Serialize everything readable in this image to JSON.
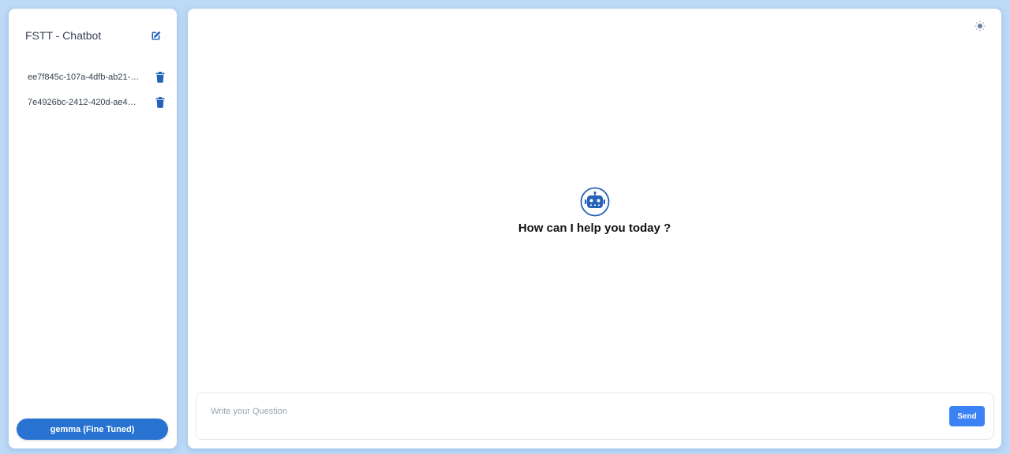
{
  "sidebar": {
    "title": "FSTT - Chatbot",
    "new_chat_icon": "edit-icon",
    "chats": [
      {
        "label": "ee7f845c-107a-4dfb-ab21-a…",
        "delete_icon": "trash-icon"
      },
      {
        "label": "7e4926bc-2412-420d-ae46-…",
        "delete_icon": "trash-icon"
      }
    ],
    "model_label": "gemma (Fine Tuned)"
  },
  "main": {
    "theme_icon": "sun-icon",
    "bot_icon": "robot-icon",
    "welcome_text": "How can I help you today ?",
    "input": {
      "placeholder": "Write your Question",
      "value": ""
    },
    "send_label": "Send"
  },
  "colors": {
    "background": "#bcd9f6",
    "accent": "#2873d1",
    "send": "#3b82f6"
  }
}
